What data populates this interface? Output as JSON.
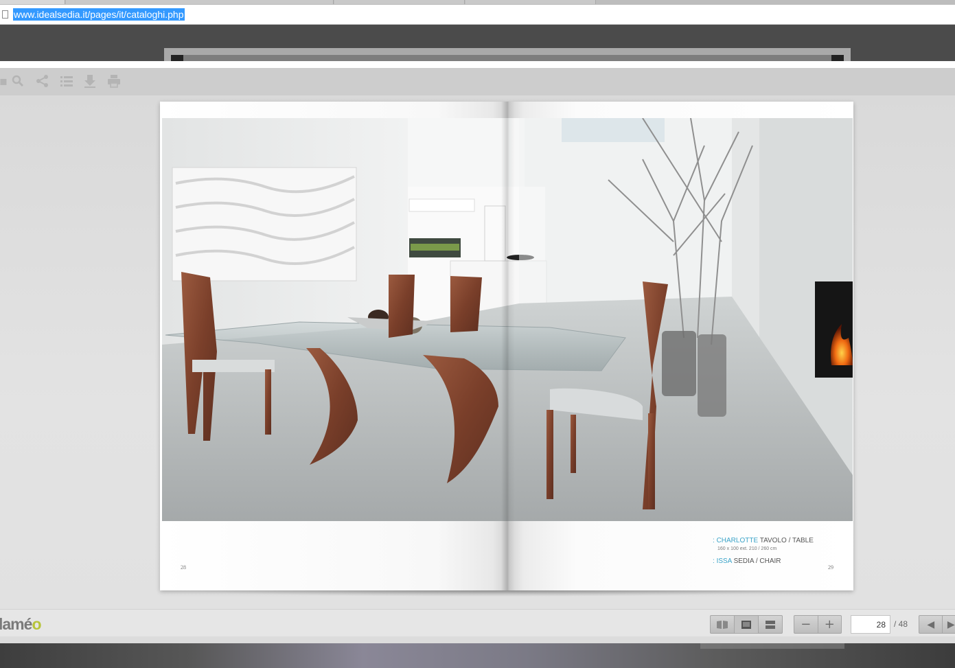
{
  "browser": {
    "url": "www.idealsedia.it/pages/it/cataloghi.php"
  },
  "viewer": {
    "toolbar_icons": [
      "search-icon",
      "share-icon",
      "list-icon",
      "download-icon",
      "print-icon"
    ],
    "spread": {
      "left_page_number": "28",
      "right_page_number": "29",
      "caption": {
        "item1_name": "CHARLOTTE",
        "item1_desc": " TAVOLO / TABLE",
        "item1_dims": "160 x 100 ext. 210 / 260 cm",
        "item2_name": "ISSA",
        "item2_desc": " SEDIA / CHAIR",
        "bullet": ":"
      }
    },
    "bottom": {
      "logo_text": "lamé",
      "logo_accent": "o",
      "view_icons": [
        "book-view-icon",
        "single-page-icon",
        "scroll-view-icon"
      ],
      "zoom_out": "−",
      "zoom_in": "+",
      "current_page": "28",
      "total_pages": "/ 48",
      "prev": "◀",
      "next": "▶"
    }
  },
  "colors": {
    "accent_caption": "#3aa3c8",
    "wood": "#8a4a33",
    "url_highlight": "#3399ff"
  }
}
